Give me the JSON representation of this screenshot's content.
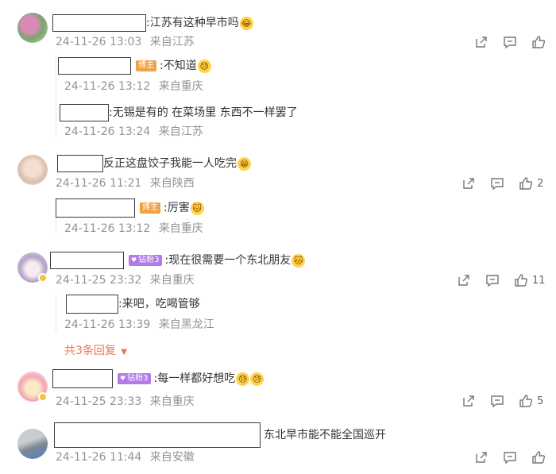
{
  "comments": [
    {
      "text": ":江苏有这种早市吗",
      "emojis": [
        "😂"
      ],
      "date": "24-11-26 13:03",
      "location": "来自江苏",
      "like_count": "",
      "replies": [
        {
          "badge": "博主",
          "text": ":不知道",
          "emojis": [
            "😓"
          ],
          "date": "24-11-26 13:12",
          "location": "来自重庆"
        },
        {
          "badge": "",
          "text": ":无锡是有的 在菜场里 东西不一样罢了",
          "emojis": [],
          "date": "24-11-26 13:24",
          "location": "来自江苏"
        }
      ]
    },
    {
      "text": "反正这盘饺子我能一人吃完",
      "emojis": [
        "😁"
      ],
      "date": "24-11-26 11:21",
      "location": "来自陕西",
      "like_count": "2",
      "replies": [
        {
          "badge": "博主",
          "text": ":厉害",
          "emojis": [
            "🐱"
          ],
          "date": "24-11-26 13:12",
          "location": "来自重庆"
        }
      ]
    },
    {
      "badge": "钻粉3",
      "text": ":现在很需要一个东北朋友",
      "emojis": [
        "🐱"
      ],
      "date": "24-11-25 23:32",
      "location": "来自重庆",
      "like_count": "11",
      "replies": [
        {
          "badge": "",
          "text": ":来吧，吃喝管够",
          "emojis": [],
          "date": "24-11-26 13:39",
          "location": "来自黑龙江"
        }
      ],
      "more_replies": "共3条回复"
    },
    {
      "badge": "钻粉3",
      "text": ":每一样都好想吃",
      "emojis": [
        "😓",
        "😓"
      ],
      "date": "24-11-25 23:33",
      "location": "来自重庆",
      "like_count": "5",
      "replies": []
    },
    {
      "text": "东北早市能不能全国巡开",
      "emojis": [],
      "date": "24-11-26 11:44",
      "location": "来自安徽",
      "like_count": "",
      "replies": []
    }
  ],
  "icons": {
    "share": "share-icon",
    "comment": "comment-icon",
    "like": "like-icon",
    "expand": "caret-down-icon"
  },
  "colors": {
    "meta": "#939393",
    "accent": "#eb7350",
    "blogger_badge": "#f0a248",
    "fan_badge": "#b37ae8"
  }
}
